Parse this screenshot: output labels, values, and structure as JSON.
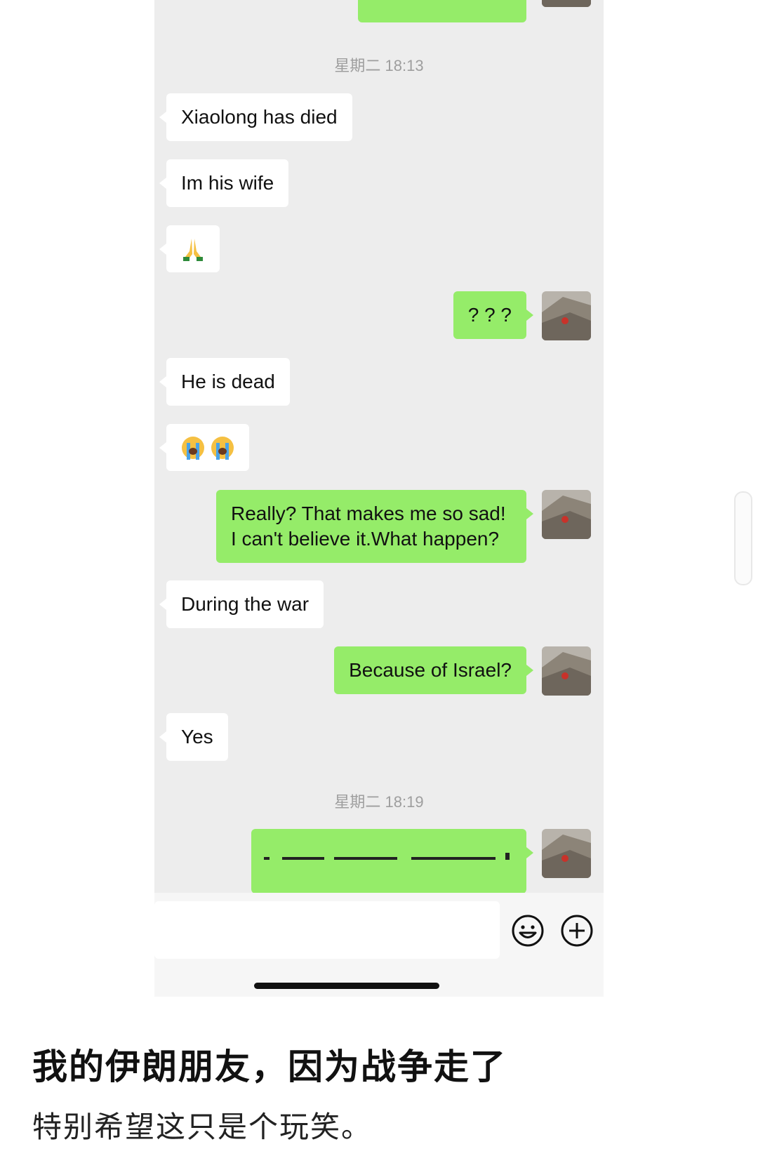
{
  "chat": {
    "timestamps": [
      "星期二 18:13",
      "星期二 18:19"
    ],
    "messages": [
      {
        "from": "them",
        "text": "Xiaolong has died"
      },
      {
        "from": "them",
        "text": "Im his wife"
      },
      {
        "from": "them",
        "emoji": "folded-hands"
      },
      {
        "from": "me",
        "text": "? ? ?"
      },
      {
        "from": "them",
        "text": "He is dead"
      },
      {
        "from": "them",
        "emoji": "loudly-crying-face x2"
      },
      {
        "from": "me",
        "text": "Really? That makes me so sad! I can't believe it.What happen?"
      },
      {
        "from": "them",
        "text": "During the war"
      },
      {
        "from": "me",
        "text": "Because of Israel?"
      },
      {
        "from": "them",
        "text": "Yes"
      }
    ]
  },
  "input_bar": {
    "emoji_button_icon": "smiley-face-icon",
    "more_button_icon": "plus-circle-icon"
  },
  "caption": {
    "title": "我的伊朗朋友，因为战争走了",
    "subtitle": "特别希望这只是个玩笑。"
  },
  "colors": {
    "sent_bubble": "#95ec69",
    "received_bubble": "#ffffff",
    "chat_background": "#ededed"
  }
}
